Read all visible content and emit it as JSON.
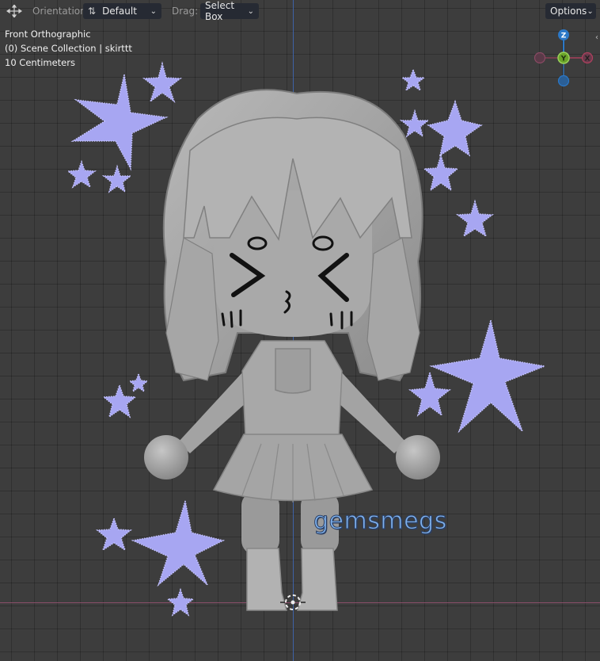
{
  "header": {
    "orientation_label": "Orientation:",
    "orientation_value": "Default",
    "drag_label": "Drag:",
    "drag_value": "Select Box",
    "options_label": "Options"
  },
  "overlay": {
    "view_name": "Front Orthographic",
    "collection": "(0) Scene Collection | skirttt",
    "scale": "10 Centimeters"
  },
  "gizmo": {
    "z_label": "Z",
    "y_label": "Y",
    "x_label": "X",
    "z_color": "#2b78c7",
    "y_color": "#6aa329",
    "x_color": "#b0405e"
  },
  "watermark": "gemsmegs",
  "colors": {
    "star": "#a7a6f2",
    "model": "#a9a9a9",
    "background": "#3d3d3d"
  }
}
